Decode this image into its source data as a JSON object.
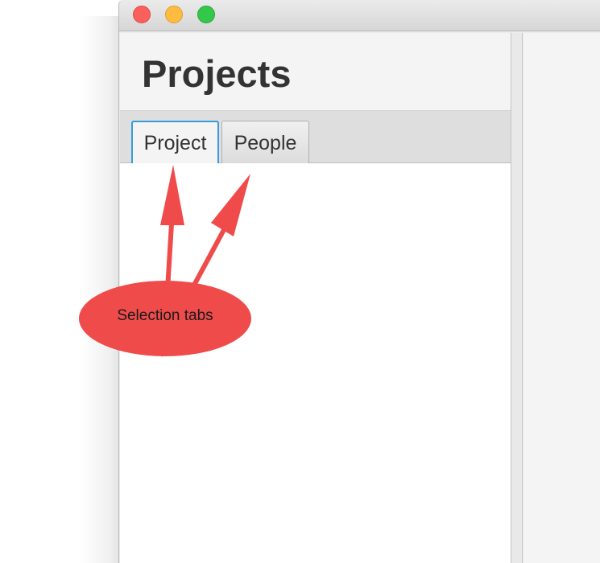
{
  "window": {
    "title_bar": {
      "buttons": [
        {
          "name": "close",
          "color": "#fc605c"
        },
        {
          "name": "minimize",
          "color": "#fdbc40"
        },
        {
          "name": "maximize",
          "color": "#34c84a"
        }
      ]
    }
  },
  "main": {
    "title": "Projects",
    "tabs": [
      {
        "label": "Project",
        "selected": true
      },
      {
        "label": "People",
        "selected": false
      }
    ]
  },
  "annotation": {
    "label": "Selection tabs",
    "color": "#ef4b4b"
  },
  "colors": {
    "accent": "#3a9bdc",
    "annotation": "#ef4b4b"
  }
}
